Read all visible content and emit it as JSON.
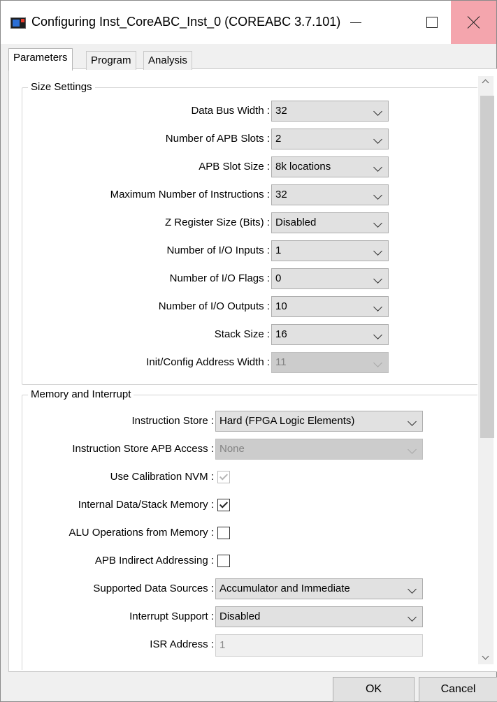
{
  "window": {
    "title": "Configuring Inst_CoreABC_Inst_0 (COREABC 3.7.101)"
  },
  "tabs": [
    {
      "label": "Parameters",
      "active": true
    },
    {
      "label": "Program",
      "active": false
    },
    {
      "label": "Analysis",
      "active": false
    }
  ],
  "size_settings": {
    "title": "Size Settings",
    "fields": [
      {
        "label": "Data Bus Width :",
        "value": "32",
        "disabled": false
      },
      {
        "label": "Number of APB Slots :",
        "value": "2",
        "disabled": false
      },
      {
        "label": "APB Slot Size :",
        "value": "8k locations",
        "disabled": false
      },
      {
        "label": "Maximum Number of Instructions :",
        "value": "32",
        "disabled": false
      },
      {
        "label": "Z Register Size (Bits) :",
        "value": "Disabled",
        "disabled": false
      },
      {
        "label": "Number of I/O Inputs :",
        "value": "1",
        "disabled": false
      },
      {
        "label": "Number of I/O Flags :",
        "value": "0",
        "disabled": false
      },
      {
        "label": "Number of I/O Outputs :",
        "value": "10",
        "disabled": false
      },
      {
        "label": "Stack Size :",
        "value": "16",
        "disabled": false
      },
      {
        "label": "Init/Config Address Width :",
        "value": "11",
        "disabled": true
      }
    ]
  },
  "memory_interrupt": {
    "title": "Memory and Interrupt",
    "instruction_store": {
      "label": "Instruction Store :",
      "value": "Hard (FPGA Logic Elements)"
    },
    "instruction_store_apb": {
      "label": "Instruction Store APB Access :",
      "value": "None"
    },
    "use_calibration_nvm": {
      "label": "Use Calibration NVM :",
      "checked": true,
      "disabled": true
    },
    "internal_data_stack": {
      "label": "Internal Data/Stack Memory :",
      "checked": true,
      "disabled": false
    },
    "alu_from_memory": {
      "label": "ALU Operations from Memory :",
      "checked": false,
      "disabled": false
    },
    "apb_indirect": {
      "label": "APB Indirect Addressing :",
      "checked": false,
      "disabled": false
    },
    "supported_data_sources": {
      "label": "Supported Data Sources :",
      "value": "Accumulator and Immediate"
    },
    "interrupt_support": {
      "label": "Interrupt Support :",
      "value": "Disabled"
    },
    "isr_address": {
      "label": "ISR Address :",
      "value": "1"
    }
  },
  "buttons": {
    "ok": "OK",
    "cancel": "Cancel"
  },
  "colors": {
    "close_hover": "#f4a5ad",
    "combo_bg": "#e1e1e1",
    "disabled_bg": "#cccccc"
  }
}
